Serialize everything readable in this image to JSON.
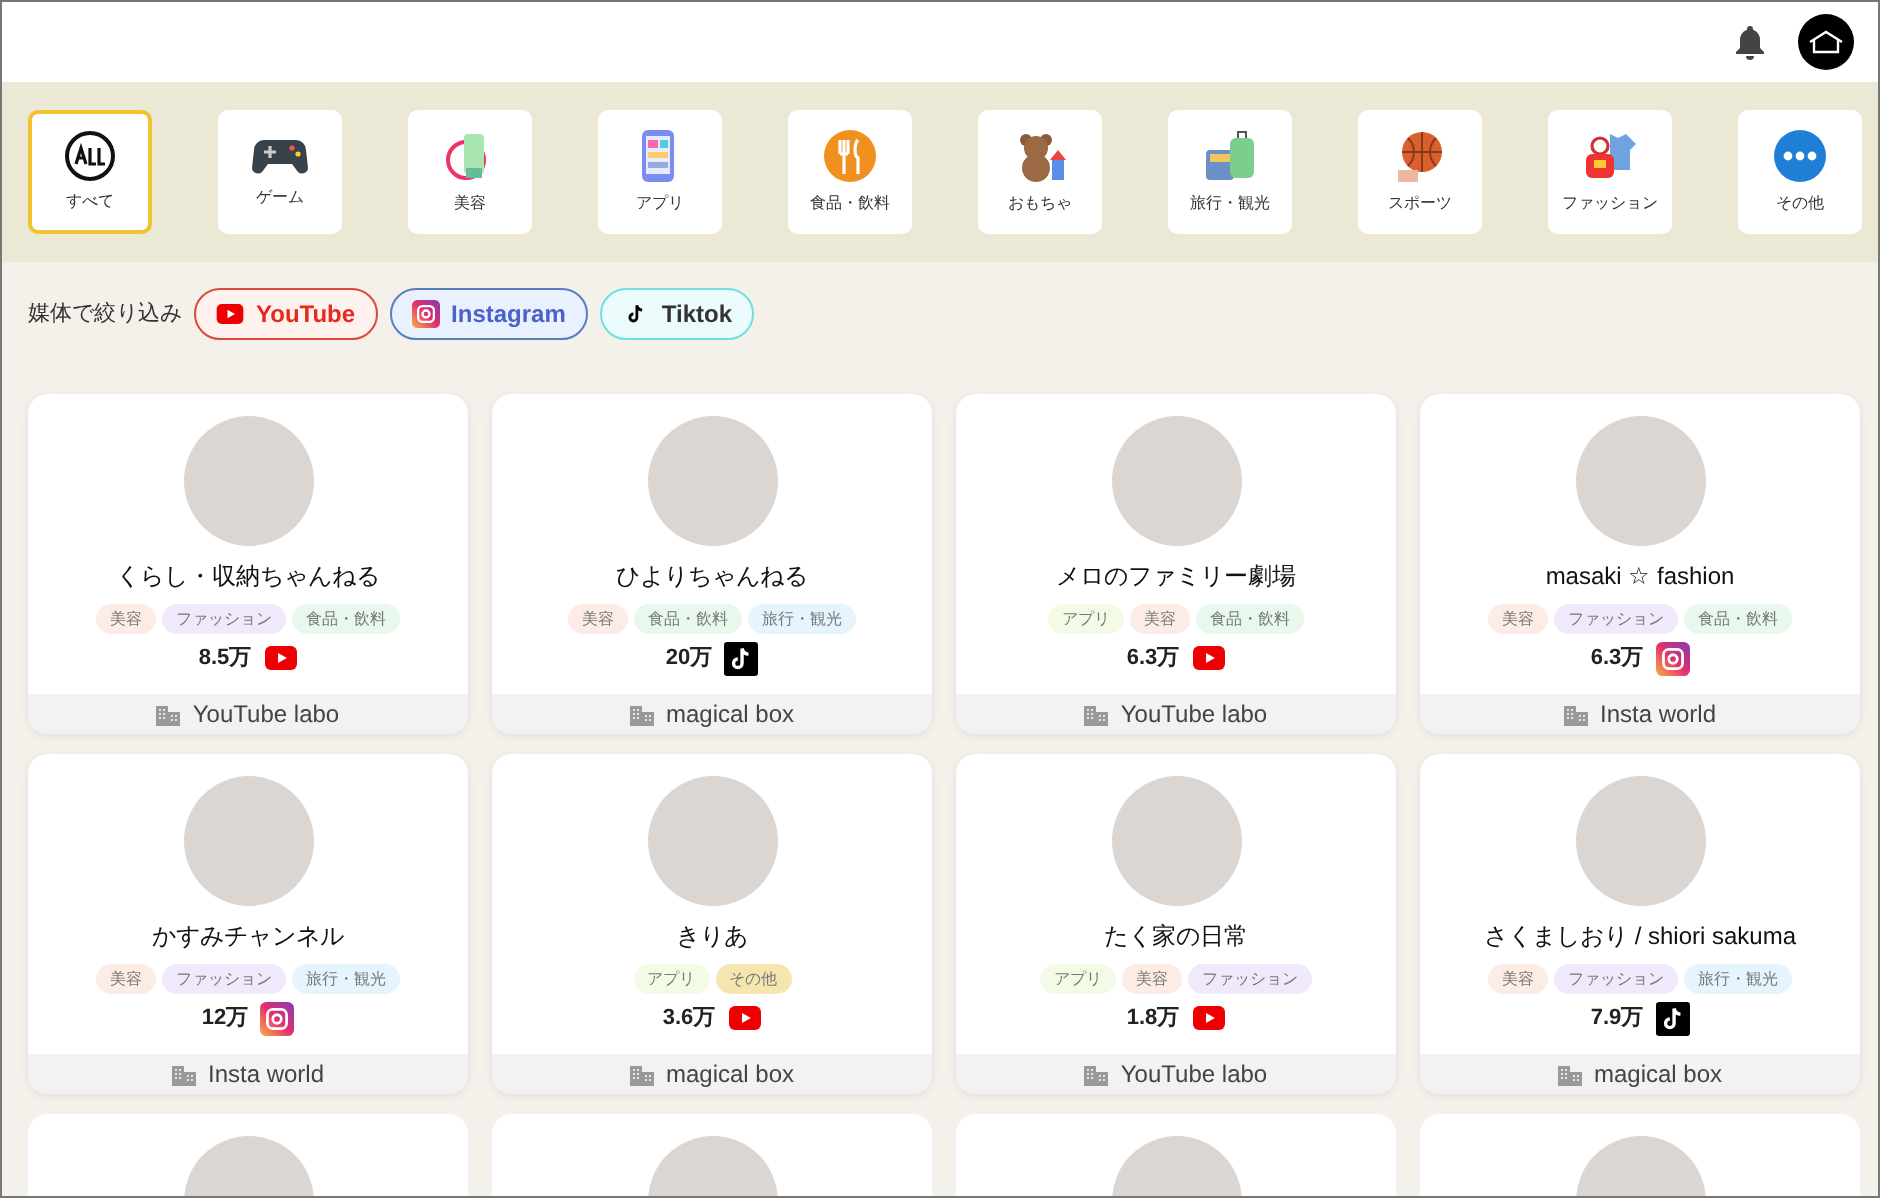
{
  "categories": [
    {
      "label": "すべて",
      "selected": true
    },
    {
      "label": "ゲーム",
      "selected": false
    },
    {
      "label": "美容",
      "selected": false
    },
    {
      "label": "アプリ",
      "selected": false
    },
    {
      "label": "食品・飲料",
      "selected": false
    },
    {
      "label": "おもちゃ",
      "selected": false
    },
    {
      "label": "旅行・観光",
      "selected": false
    },
    {
      "label": "スポーツ",
      "selected": false
    },
    {
      "label": "ファッション",
      "selected": false
    },
    {
      "label": "その他",
      "selected": false
    }
  ],
  "filter": {
    "label": "媒体で絞り込み",
    "options": [
      {
        "kind": "youtube",
        "label": "YouTube"
      },
      {
        "kind": "instagram",
        "label": "Instagram"
      },
      {
        "kind": "tiktok",
        "label": "Tiktok"
      }
    ]
  },
  "creators": [
    {
      "name": "くらし・収納ちゃんねる",
      "tags": [
        {
          "label": "美容",
          "color": "#fdece6"
        },
        {
          "label": "ファッション",
          "color": "#efe9fb"
        },
        {
          "label": "食品・飲料",
          "color": "#e8f8ec"
        }
      ],
      "followers": "8.5万",
      "kind": "youtube",
      "agency": "YouTube labo"
    },
    {
      "name": "ひよりちゃんねる",
      "tags": [
        {
          "label": "美容",
          "color": "#fdece6"
        },
        {
          "label": "食品・飲料",
          "color": "#e8f8ec"
        },
        {
          "label": "旅行・観光",
          "color": "#e6f4fd"
        }
      ],
      "followers": "20万",
      "kind": "tiktok",
      "agency": "magical box"
    },
    {
      "name": "メロのファミリー劇場",
      "tags": [
        {
          "label": "アプリ",
          "color": "#f3fbe6"
        },
        {
          "label": "美容",
          "color": "#fdece6"
        },
        {
          "label": "食品・飲料",
          "color": "#e8f8ec"
        }
      ],
      "followers": "6.3万",
      "kind": "youtube",
      "agency": "YouTube labo"
    },
    {
      "name": "masaki ☆ fashion",
      "tags": [
        {
          "label": "美容",
          "color": "#fdece6"
        },
        {
          "label": "ファッション",
          "color": "#efe9fb"
        },
        {
          "label": "食品・飲料",
          "color": "#e8f8ec"
        }
      ],
      "followers": "6.3万",
      "kind": "instagram",
      "agency": "Insta world"
    },
    {
      "name": "かすみチャンネル",
      "tags": [
        {
          "label": "美容",
          "color": "#fdece6"
        },
        {
          "label": "ファッション",
          "color": "#efe9fb"
        },
        {
          "label": "旅行・観光",
          "color": "#e6f4fd"
        }
      ],
      "followers": "12万",
      "kind": "instagram",
      "agency": "Insta world"
    },
    {
      "name": "きりあ",
      "tags": [
        {
          "label": "アプリ",
          "color": "#f3fbe6"
        },
        {
          "label": "その他",
          "color": "#f5e6b0"
        }
      ],
      "followers": "3.6万",
      "kind": "youtube",
      "agency": "magical box"
    },
    {
      "name": "たく家の日常",
      "tags": [
        {
          "label": "アプリ",
          "color": "#f3fbe6"
        },
        {
          "label": "美容",
          "color": "#fdece6"
        },
        {
          "label": "ファッション",
          "color": "#efe9fb"
        }
      ],
      "followers": "1.8万",
      "kind": "youtube",
      "agency": "YouTube labo"
    },
    {
      "name": "さくましおり / shiori sakuma",
      "tags": [
        {
          "label": "美容",
          "color": "#fdece6"
        },
        {
          "label": "ファッション",
          "color": "#efe9fb"
        },
        {
          "label": "旅行・観光",
          "color": "#e6f4fd"
        }
      ],
      "followers": "7.9万",
      "kind": "tiktok",
      "agency": "magical box"
    }
  ]
}
